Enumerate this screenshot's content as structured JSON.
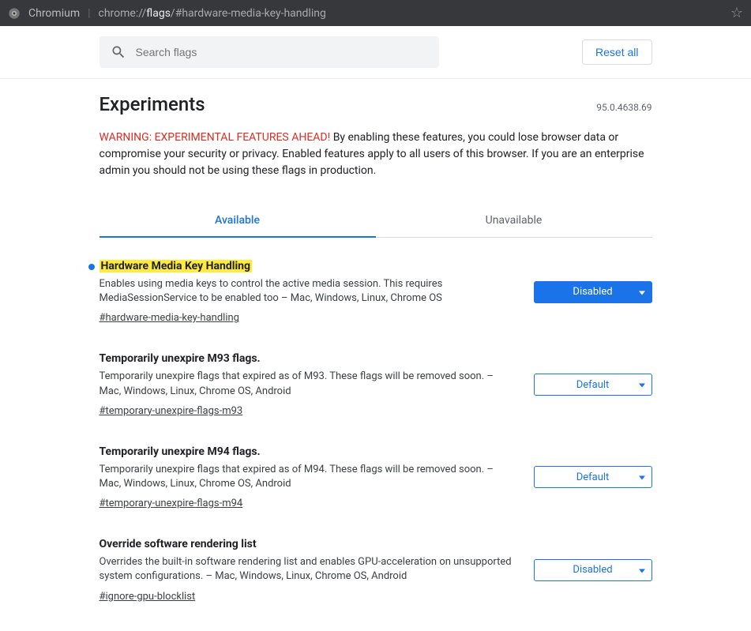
{
  "addressbar": {
    "browser": "Chromium",
    "url_prefix": "chrome://",
    "url_strong": "flags",
    "url_suffix": "/#hardware-media-key-handling"
  },
  "search": {
    "placeholder": "Search flags"
  },
  "reset_label": "Reset all",
  "heading": "Experiments",
  "version": "95.0.4638.69",
  "warning": {
    "lead": "WARNING: EXPERIMENTAL FEATURES AHEAD!",
    "body": " By enabling these features, you could lose browser data or compromise your security or privacy. Enabled features apply to all users of this browser. If you are an enterprise admin you should not be using these flags in production."
  },
  "tabs": {
    "available": "Available",
    "unavailable": "Unavailable"
  },
  "flags": [
    {
      "title": "Hardware Media Key Handling",
      "desc": "Enables using media keys to control the active media session. This requires MediaSessionService to be enabled too – Mac, Windows, Linux, Chrome OS",
      "link": "#hardware-media-key-handling",
      "value": "Disabled",
      "highlighted": true,
      "modified": true,
      "filled": true
    },
    {
      "title": "Temporarily unexpire M93 flags.",
      "desc": "Temporarily unexpire flags that expired as of M93. These flags will be removed soon. – Mac, Windows, Linux, Chrome OS, Android",
      "link": "#temporary-unexpire-flags-m93",
      "value": "Default",
      "highlighted": false,
      "modified": false,
      "filled": false
    },
    {
      "title": "Temporarily unexpire M94 flags.",
      "desc": "Temporarily unexpire flags that expired as of M94. These flags will be removed soon. – Mac, Windows, Linux, Chrome OS, Android",
      "link": "#temporary-unexpire-flags-m94",
      "value": "Default",
      "highlighted": false,
      "modified": false,
      "filled": false
    },
    {
      "title": "Override software rendering list",
      "desc": "Overrides the built-in software rendering list and enables GPU-acceleration on unsupported system configurations. – Mac, Windows, Linux, Chrome OS, Android",
      "link": "#ignore-gpu-blocklist",
      "value": "Disabled",
      "highlighted": false,
      "modified": false,
      "filled": false
    }
  ]
}
